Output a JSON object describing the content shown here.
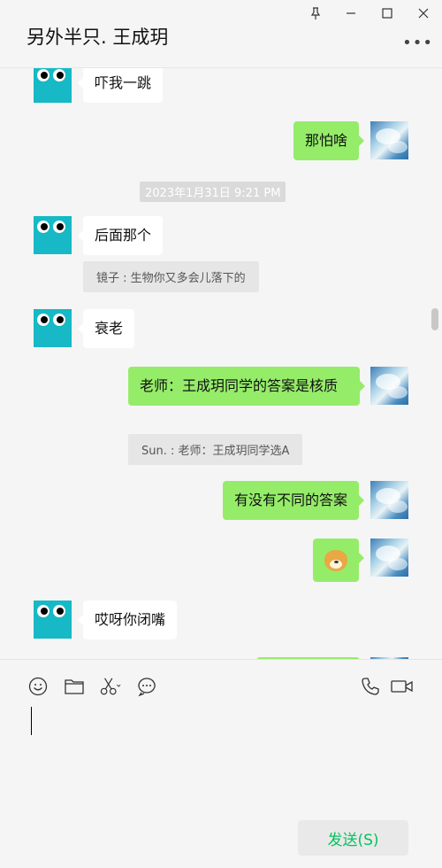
{
  "window": {
    "title": "另外半只. 王成玥",
    "pin_icon": "pin-icon",
    "minimize_icon": "minimize-icon",
    "maximize_icon": "maximize-icon",
    "close_icon": "close-icon",
    "more_icon": "more-icon"
  },
  "chat": {
    "timestamp": "2023年1月31日 9:21 PM",
    "messages": [
      {
        "side": "left",
        "text": "吓我一跳"
      },
      {
        "side": "right",
        "text": "那怕啥"
      },
      {
        "side": "left",
        "text": "后面那个"
      },
      {
        "side": "left",
        "text": "衰老"
      },
      {
        "side": "right",
        "text": "老师：王成玥同学的答案是核质"
      },
      {
        "side": "right",
        "text": "有没有不同的答案"
      },
      {
        "side": "right",
        "text": "doge-emoji"
      },
      {
        "side": "left",
        "text": "哎呀你闭嘴"
      }
    ],
    "quotes": [
      "镜子 : 生物你又多会儿落下的",
      "Sun. : 老师：王成玥同学选A"
    ],
    "colors": {
      "bubble_self": "#95ec69",
      "bubble_other": "#ffffff",
      "avatar_robot": "#16b9c5"
    }
  },
  "toolbar": {
    "icons": [
      "emoji-icon",
      "folder-icon",
      "scissors-icon",
      "chat-bubble-icon",
      "phone-icon",
      "video-icon"
    ]
  },
  "send": {
    "label": "发送(S)",
    "color": "#07c160"
  }
}
